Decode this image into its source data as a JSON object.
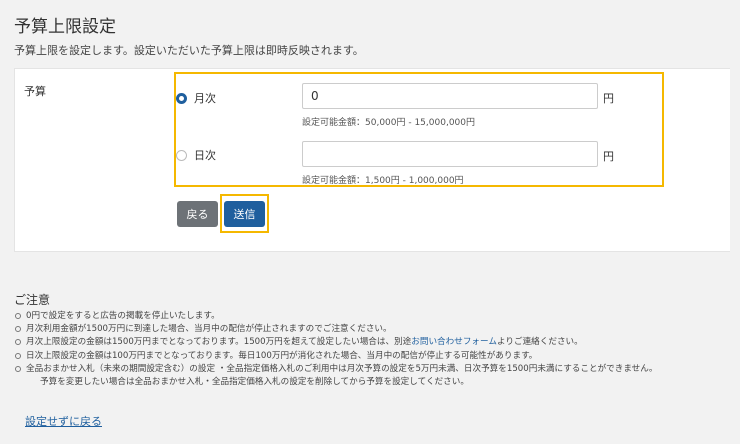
{
  "header": {
    "title": "予算上限設定",
    "description": "予算上限を設定します。設定いただいた予算上限は即時反映されます。"
  },
  "budget": {
    "label": "予算",
    "monthly": {
      "radio_label": "月次",
      "selected": true,
      "value": "0",
      "unit": "円",
      "range": "設定可能金額：50,000円 - 15,000,000円"
    },
    "daily": {
      "radio_label": "日次",
      "selected": false,
      "value": "",
      "unit": "円",
      "range": "設定可能金額：1,500円 - 1,000,000円"
    }
  },
  "buttons": {
    "back": "戻る",
    "submit": "送信"
  },
  "notes": {
    "title": "ご注意",
    "item1": "0円で設定をすると広告の掲載を停止いたします。",
    "item2": "月次利用金額が1500万円に到達した場合、当月中の配信が停止されますのでご注意ください。",
    "item3_before": "月次上限設定の金額は1500万円までとなっております。1500万円を超えて設定したい場合は、別途",
    "item3_link": "お問い合わせフォーム",
    "item3_after": "よりご連絡ください。",
    "item4": "日次上限設定の金額は100万円までとなっております。毎日100万円が消化された場合、当月中の配信が停止する可能性があります。",
    "item5_line1": "全品おまかせ入札（未来の期間設定含む）の設定 ・全品指定価格入札のご利用中は月次予算の設定を5万円未満、日次予算を1500円未満にすることができません。",
    "item5_line2": "予算を変更したい場合は全品おまかせ入札・全品指定価格入札の設定を削除してから予算を設定してください。"
  },
  "footer": {
    "back_link": "設定せずに戻る"
  },
  "colors": {
    "accent": "#1f5f9e",
    "highlight": "#f5b800",
    "back_button": "#6d7277"
  }
}
